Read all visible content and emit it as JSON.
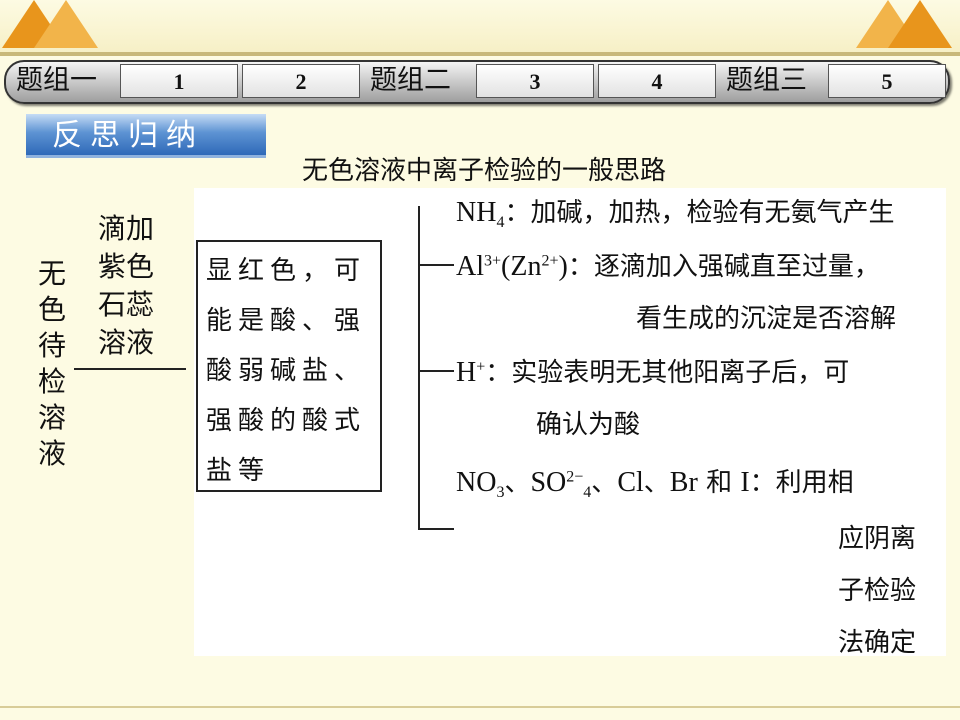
{
  "nav": {
    "group1": "题组一",
    "group2": "题组二",
    "group3": "题组三",
    "numbers": [
      "1",
      "2",
      "3",
      "4",
      "5"
    ]
  },
  "section_title": "反思归纳",
  "heading": "无色溶液中离子检验的一般思路",
  "left_label": [
    "无",
    "色",
    "待",
    "检",
    "溶",
    "液"
  ],
  "reagent": [
    "滴加",
    "紫色",
    "石蕊",
    "溶液"
  ],
  "result": [
    "显红色，可",
    "能是酸、强",
    "酸弱碱盐、",
    "强酸的酸式",
    "盐等"
  ],
  "ions": {
    "nh4": {
      "formula": "NH",
      "sub": "4",
      "text": "：加碱，加热，检验有无氨气产生"
    },
    "al": {
      "al_base": "Al",
      "al_sup": "3+",
      "open": "(",
      "zn_base": "Zn",
      "zn_sup": "2+",
      "close": ")",
      "text1": "：逐滴加入强碱直至过量，",
      "text2": "看生成的沉淀是否溶解"
    },
    "h": {
      "base": "H",
      "sup": "+",
      "text1": "：实验表明无其他阳离子后，可",
      "text2": "确认为酸"
    },
    "anions": {
      "no3": "NO",
      "no3_sub": "3",
      "sep1": "、",
      "so4": "SO",
      "so4_sup": "2−",
      "so4_sub": "4",
      "sep2": "、",
      "cl": "Cl",
      "sep3": "、",
      "br": "Br",
      "he": "和",
      "i": "I",
      "text": "：利用相",
      "lines": [
        "应阴离",
        "子检验",
        "法确定"
      ]
    }
  },
  "colors": {
    "accent_orange": "#e8951c",
    "background": "#fdfbe3",
    "title_blue": "#2f69b8"
  }
}
